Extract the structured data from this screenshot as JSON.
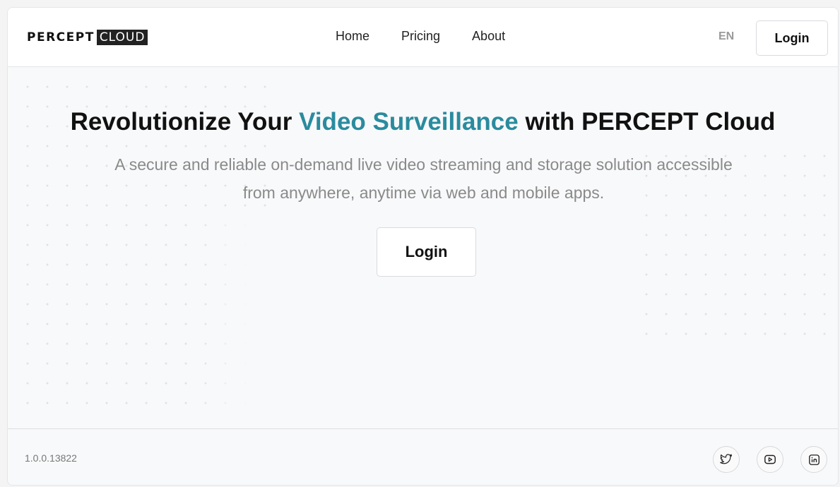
{
  "header": {
    "logo": {
      "word": "PERCEPT",
      "box": "CLOUD"
    },
    "nav": [
      {
        "label": "Home"
      },
      {
        "label": "Pricing"
      },
      {
        "label": "About"
      }
    ],
    "language": "EN",
    "login_label": "Login"
  },
  "hero": {
    "title_before": "Revolutionize Your ",
    "title_accent": "Video Surveillance",
    "title_after": " with PERCEPT Cloud",
    "subtitle": "A secure and reliable on-demand live video streaming and storage solution accessible from anywhere, anytime via web and mobile apps.",
    "login_label": "Login"
  },
  "footer": {
    "version": "1.0.0.13822",
    "social": [
      {
        "icon": "twitter-icon"
      },
      {
        "icon": "youtube-icon"
      },
      {
        "icon": "linkedin-icon"
      }
    ]
  },
  "colors": {
    "accent": "#2a8b9e",
    "text": "#111111",
    "muted": "#8a8a8a",
    "background": "#f8f9fa"
  }
}
